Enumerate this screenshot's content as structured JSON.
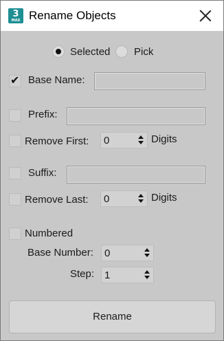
{
  "window": {
    "title": "Rename Objects",
    "app_icon": {
      "glyph": "3",
      "sub": "MAX",
      "color": "#1f8f94"
    }
  },
  "source": {
    "options": [
      {
        "label": "Selected",
        "checked": true
      },
      {
        "label": "Pick",
        "checked": false
      }
    ]
  },
  "base_name": {
    "label": "Base Name:",
    "checked": true,
    "value": ""
  },
  "prefix": {
    "label": "Prefix:",
    "checked": false,
    "value": ""
  },
  "remove_first": {
    "label": "Remove First:",
    "checked": false,
    "value": "0",
    "unit": "Digits"
  },
  "suffix": {
    "label": "Suffix:",
    "checked": false,
    "value": ""
  },
  "remove_last": {
    "label": "Remove Last:",
    "checked": false,
    "value": "0",
    "unit": "Digits"
  },
  "numbered": {
    "label": "Numbered",
    "checked": false,
    "base_number": {
      "label": "Base Number:",
      "value": "0"
    },
    "step": {
      "label": "Step:",
      "value": "1"
    }
  },
  "actions": {
    "rename_label": "Rename"
  },
  "icons": {
    "check": "✔",
    "close": "close-icon"
  }
}
